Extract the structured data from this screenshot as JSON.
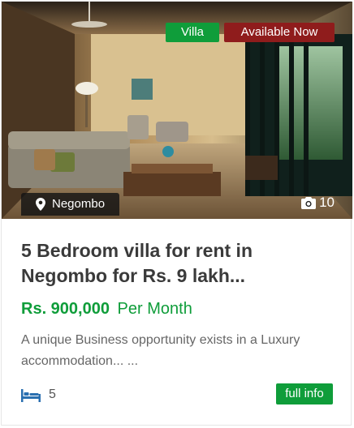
{
  "listing": {
    "type_badge": "Villa",
    "status_badge": "Available Now",
    "location": "Negombo",
    "photo_count": "10",
    "title": "5 Bedroom villa for rent in Negombo for Rs. 9 lakh...",
    "price_amount": "Rs. 900,000",
    "price_period": "Per Month",
    "description": "A unique Business opportunity exists in a Luxury accommodation... ...",
    "bedrooms": "5",
    "more_button": "full info"
  },
  "colors": {
    "accent_green": "#0f9d3a",
    "status_red": "#8f1c1c"
  },
  "icons": {
    "location": "map-pin-icon",
    "photos": "camera-icon",
    "bedrooms": "bed-icon"
  }
}
